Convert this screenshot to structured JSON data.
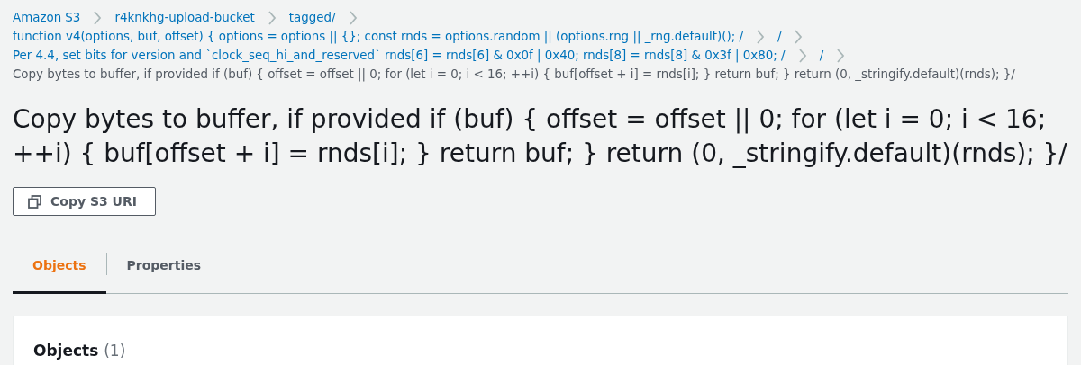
{
  "breadcrumbs": [
    {
      "label": "Amazon S3",
      "current": false
    },
    {
      "label": "r4knkhg-upload-bucket",
      "current": false
    },
    {
      "label": "tagged/",
      "current": false
    },
    {
      "label": "function v4(options, buf, offset) { options = options || {}; const rnds = options.random || (options.rng || _rng.default)(); /",
      "current": false
    },
    {
      "label": "/",
      "current": false
    },
    {
      "label": "Per 4.4, set bits for version and `clock_seq_hi_and_reserved` rnds[6] = rnds[6] & 0x0f | 0x40; rnds[8] = rnds[8] & 0x3f | 0x80; /",
      "current": false
    },
    {
      "label": "/",
      "current": false
    },
    {
      "label": "Copy bytes to buffer, if provided if (buf) { offset = offset || 0; for (let i = 0; i < 16; ++i) { buf[offset + i] = rnds[i]; } return buf; } return (0, _stringify.default)(rnds); }/",
      "current": true
    }
  ],
  "title": "Copy bytes to buffer, if provided if (buf) { offset = offset || 0; for (let i = 0; i < 16; ++i) { buf[offset + i] = rnds[i]; } return buf; } return (0, _stringify.default)(rnds); }/",
  "copy_button": "Copy S3 URI",
  "tabs": [
    {
      "label": "Objects",
      "selected": true
    },
    {
      "label": "Properties",
      "selected": false
    }
  ],
  "objects_panel": {
    "title": "Objects",
    "count": "(1)"
  }
}
